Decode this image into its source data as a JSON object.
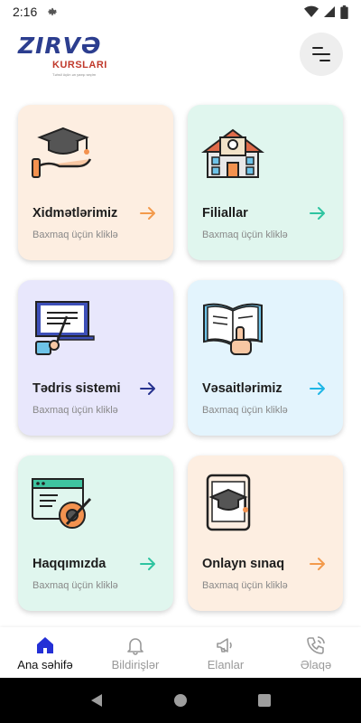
{
  "status": {
    "time": "2:16"
  },
  "logo": {
    "brand": "ZIRVƏ",
    "sub": "KURSLARI",
    "slogan": "Təhsil üçün ən yaxşı seçim"
  },
  "colors": {
    "peach": "#fdeee1",
    "mint": "#e0f6ee",
    "lavender": "#e8e7fc",
    "sky": "#e3f4fd",
    "arrow_orange": "#f39a4b",
    "arrow_green": "#2ec4a0",
    "arrow_navy": "#27338f",
    "arrow_cyan": "#1fb6e6"
  },
  "cards": [
    {
      "title": "Xidmətlərimiz",
      "subtitle": "Baxmaq üçün kliklə",
      "icon": "graduation-hand-icon"
    },
    {
      "title": "Filiallar",
      "subtitle": "Baxmaq üçün kliklə",
      "icon": "school-building-icon"
    },
    {
      "title": "Tədris sistemi",
      "subtitle": "Baxmaq üçün kliklə",
      "icon": "teaching-board-icon"
    },
    {
      "title": "Vəsaitlərimiz",
      "subtitle": "Baxmaq üçün kliklə",
      "icon": "open-book-icon"
    },
    {
      "title": "Haqqımızda",
      "subtitle": "Baxmaq üçün kliklə",
      "icon": "web-settings-icon"
    },
    {
      "title": "Onlayn sınaq",
      "subtitle": "Baxmaq üçün kliklə",
      "icon": "tablet-graduation-icon"
    }
  ],
  "nav": [
    {
      "label": "Ana səhifə",
      "icon": "home-icon",
      "active": true
    },
    {
      "label": "Bildirişlər",
      "icon": "bell-icon",
      "active": false
    },
    {
      "label": "Elanlar",
      "icon": "megaphone-icon",
      "active": false
    },
    {
      "label": "Əlaqə",
      "icon": "phone-icon",
      "active": false
    }
  ]
}
